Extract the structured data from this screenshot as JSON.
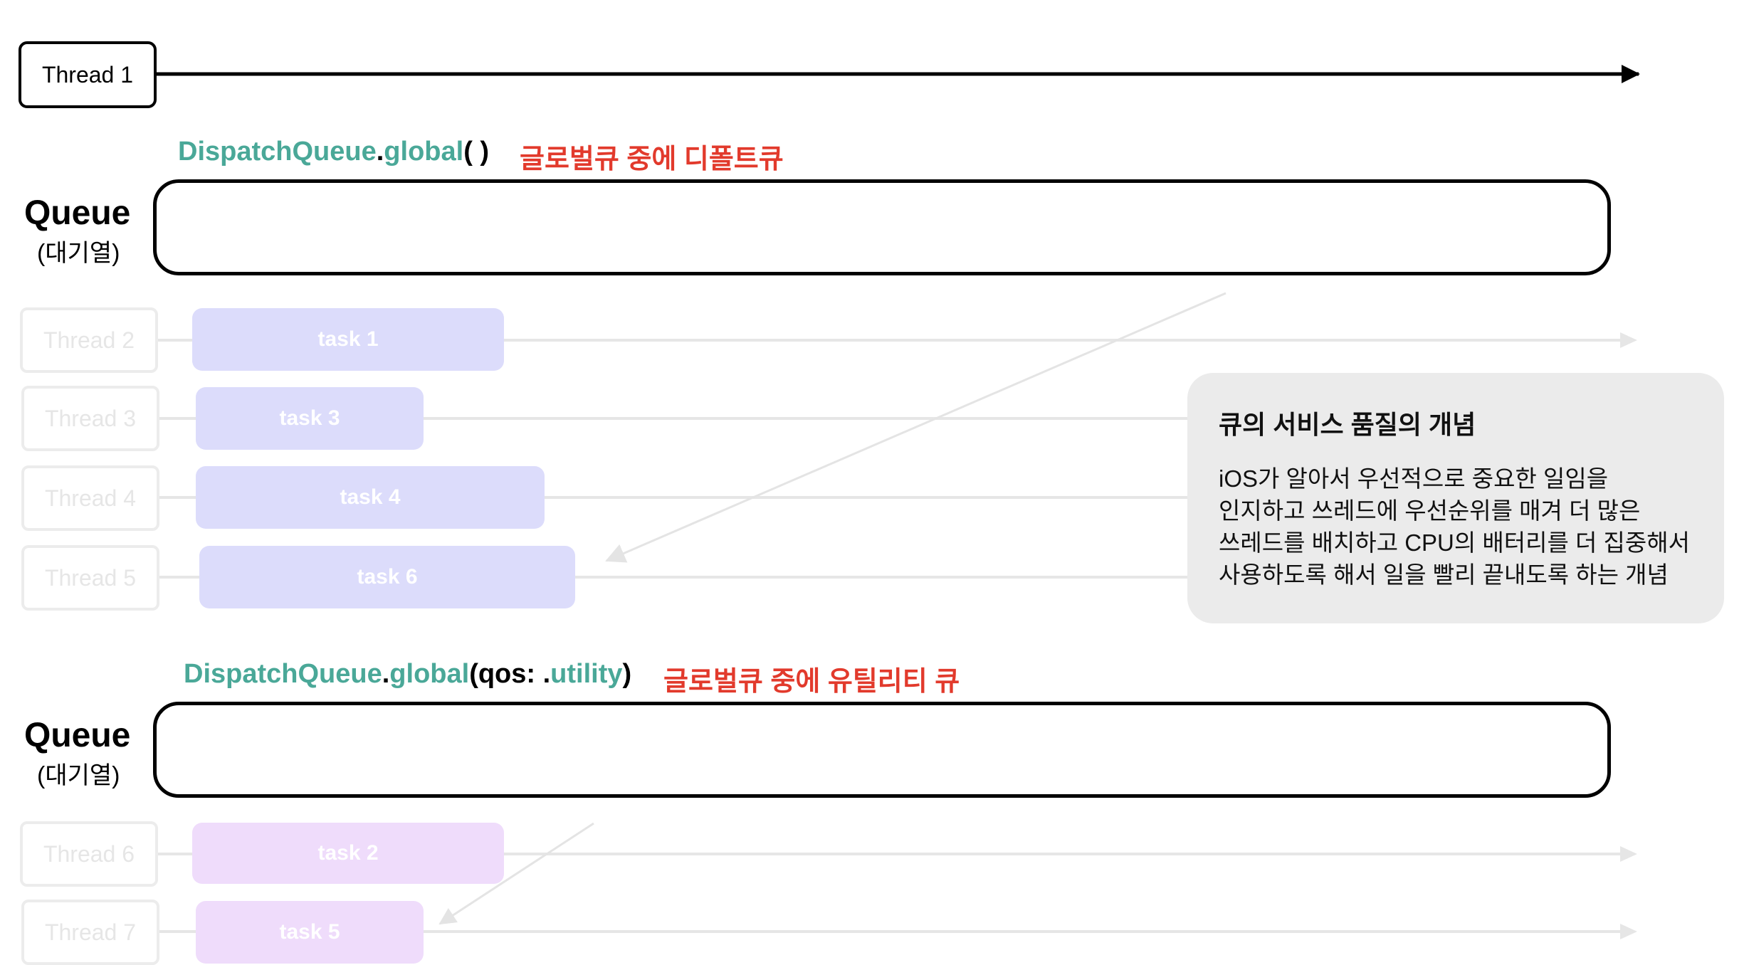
{
  "main_thread": {
    "label": "Thread 1"
  },
  "section_default": {
    "code_parts": [
      {
        "text": "DispatchQueue",
        "color": "teal"
      },
      {
        "text": ".",
        "color": "black"
      },
      {
        "text": "global",
        "color": "teal"
      },
      {
        "text": "( )",
        "color": "black"
      }
    ],
    "note": "글로벌큐 중에 디폴트큐",
    "queue_title": "Queue",
    "queue_sub": "(대기열)",
    "threads": [
      "Thread 2",
      "Thread 3",
      "Thread 4",
      "Thread 5"
    ],
    "tasks": [
      "task 1",
      "task 3",
      "task 4",
      "task 6"
    ]
  },
  "section_utility": {
    "code_parts": [
      {
        "text": "DispatchQueue",
        "color": "teal"
      },
      {
        "text": ".",
        "color": "black"
      },
      {
        "text": "global",
        "color": "teal"
      },
      {
        "text": "(qos: .",
        "color": "black"
      },
      {
        "text": "utility",
        "color": "teal"
      },
      {
        "text": ")",
        "color": "black"
      }
    ],
    "note": "글로벌큐 중에 유틸리티 큐",
    "queue_title": "Queue",
    "queue_sub": "(대기열)",
    "threads": [
      "Thread 6",
      "Thread 7"
    ],
    "tasks": [
      "task 2",
      "task 5"
    ]
  },
  "info_box": {
    "title": "큐의 서비스 품질의 개념",
    "body": "iOS가 알아서 우선적으로 중요한 일임을\n인지하고 쓰레드에 우선순위를 매겨 더 많은\n쓰레드를 배치하고 CPU의 배터리를 더 집중해서\n사용하도록 해서 일을 빨리 끝내도록 하는 개념"
  },
  "colors": {
    "teal": "#4aa898",
    "red_note": "#e23a2c",
    "task_blue": "#dcdcfb",
    "task_pink": "#efdcfb",
    "faded_gray": "#e6e6e6"
  }
}
